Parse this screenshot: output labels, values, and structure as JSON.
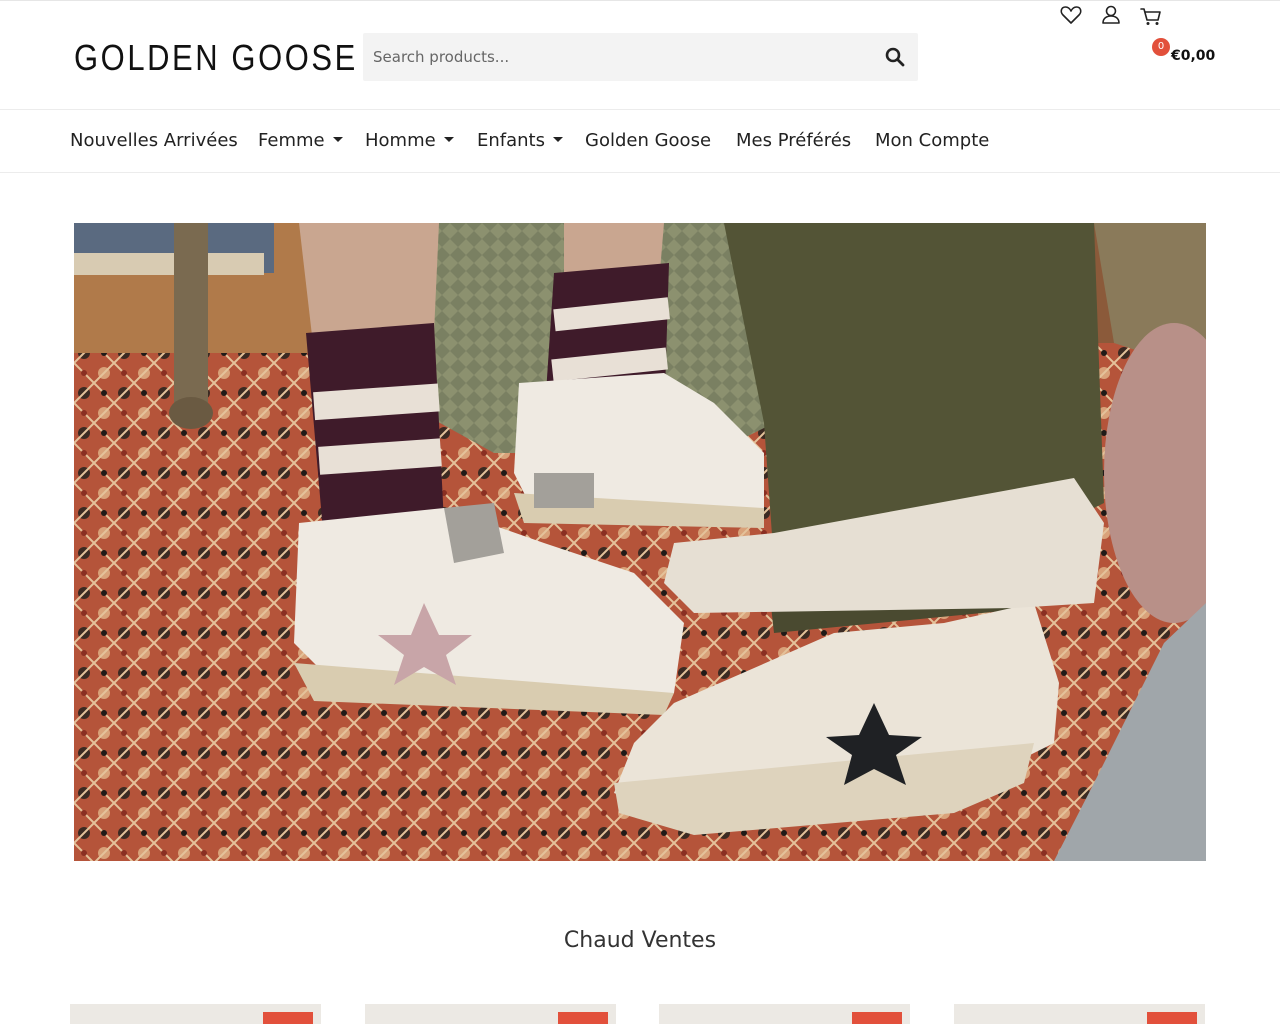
{
  "header": {
    "logo": "GOLDEN GOOSE",
    "search_placeholder": "Search products...",
    "cart_count": "0",
    "cart_total": "€0,00",
    "icons": [
      "search-icon",
      "heart-icon",
      "user-icon",
      "cart-icon"
    ]
  },
  "nav": {
    "items": [
      {
        "label": "Nouvelles Arrivées",
        "has_dropdown": false
      },
      {
        "label": "Femme",
        "has_dropdown": true
      },
      {
        "label": "Homme",
        "has_dropdown": true
      },
      {
        "label": "Enfants",
        "has_dropdown": true
      },
      {
        "label": "Golden Goose",
        "has_dropdown": false
      },
      {
        "label": "Mes Préférés",
        "has_dropdown": false
      },
      {
        "label": "Mon Compte",
        "has_dropdown": false
      }
    ]
  },
  "section": {
    "title": "Chaud Ventes"
  },
  "colors": {
    "accent": "#e2503b",
    "search_bg": "#f3f3f3",
    "text": "#222222"
  }
}
